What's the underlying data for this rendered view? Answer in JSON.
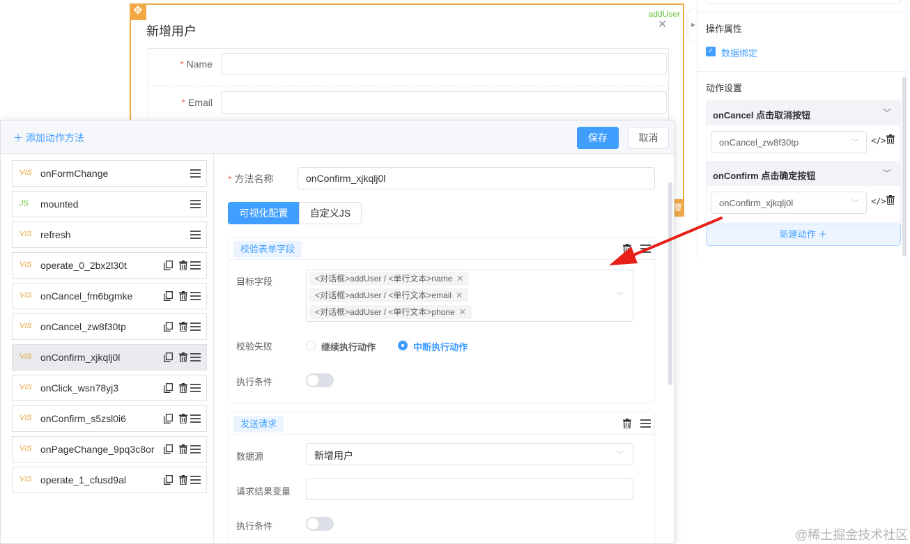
{
  "background_dialog": {
    "title": "新增用户",
    "component_tag": "addUser",
    "close_icon": "close-icon",
    "fields": [
      {
        "label": "Name",
        "required": true
      },
      {
        "label": "Email",
        "required": true
      }
    ]
  },
  "right_panel": {
    "operate_title": "操作属性",
    "data_binding_label": "数据绑定",
    "data_binding_checked": true,
    "action_settings_title": "动作设置",
    "groups": [
      {
        "title": "onCancel 点击取消按钮",
        "selected": "onCancel_zw8f30tp"
      },
      {
        "title": "onConfirm 点击确定按钮",
        "selected": "onConfirm_xjkqlj0l"
      }
    ],
    "new_action_label": "新建动作 ＋"
  },
  "action_dialog": {
    "add_method_label": "＋ 添加动作方法",
    "save_label": "保存",
    "cancel_label": "取消",
    "methods": [
      {
        "type": "VIS",
        "name": "onFormChange",
        "builtin": true
      },
      {
        "type": "JS",
        "name": "mounted",
        "builtin": true
      },
      {
        "type": "VIS",
        "name": "refresh",
        "builtin": true
      },
      {
        "type": "VIS",
        "name": "operate_0_2bx2l30t",
        "builtin": false
      },
      {
        "type": "VIS",
        "name": "onCancel_fm6bgmke",
        "builtin": false
      },
      {
        "type": "VIS",
        "name": "onCancel_zw8f30tp",
        "builtin": false
      },
      {
        "type": "VIS",
        "name": "onConfirm_xjkqlj0l",
        "builtin": false,
        "active": true
      },
      {
        "type": "VIS",
        "name": "onClick_wsn78yj3",
        "builtin": false
      },
      {
        "type": "VIS",
        "name": "onConfirm_s5zsl0i6",
        "builtin": false
      },
      {
        "type": "VIS",
        "name": "onPageChange_9pq3c8or",
        "builtin": false
      },
      {
        "type": "VIS",
        "name": "operate_1_cfusd9al",
        "builtin": false
      }
    ],
    "method_name_label": "方法名称",
    "method_name_value": "onConfirm_xjkqlj0l",
    "tabs": [
      "可视化配置",
      "自定义JS"
    ],
    "validate_card": {
      "tag": "校验表单字段",
      "target_label": "目标字段",
      "chips": [
        "<对话框>addUser / <单行文本>name",
        "<对话框>addUser / <单行文本>email",
        "<对话框>addUser / <单行文本>phone"
      ],
      "fail_label": "校验失败",
      "fail_options": [
        "继续执行动作",
        "中断执行动作"
      ],
      "fail_selected": 1,
      "condition_label": "执行条件"
    },
    "request_card": {
      "tag": "发送请求",
      "datasource_label": "数据源",
      "datasource_value": "新增用户",
      "result_var_label": "请求结果变量",
      "condition_label": "执行条件"
    }
  },
  "annotation": {
    "color": "#e8201a"
  },
  "watermark": "@稀土掘金技术社区",
  "colors": {
    "primary": "#409eff",
    "warning": "#e6a23c",
    "success": "#67c23a",
    "designer_border": "#f0a945"
  }
}
